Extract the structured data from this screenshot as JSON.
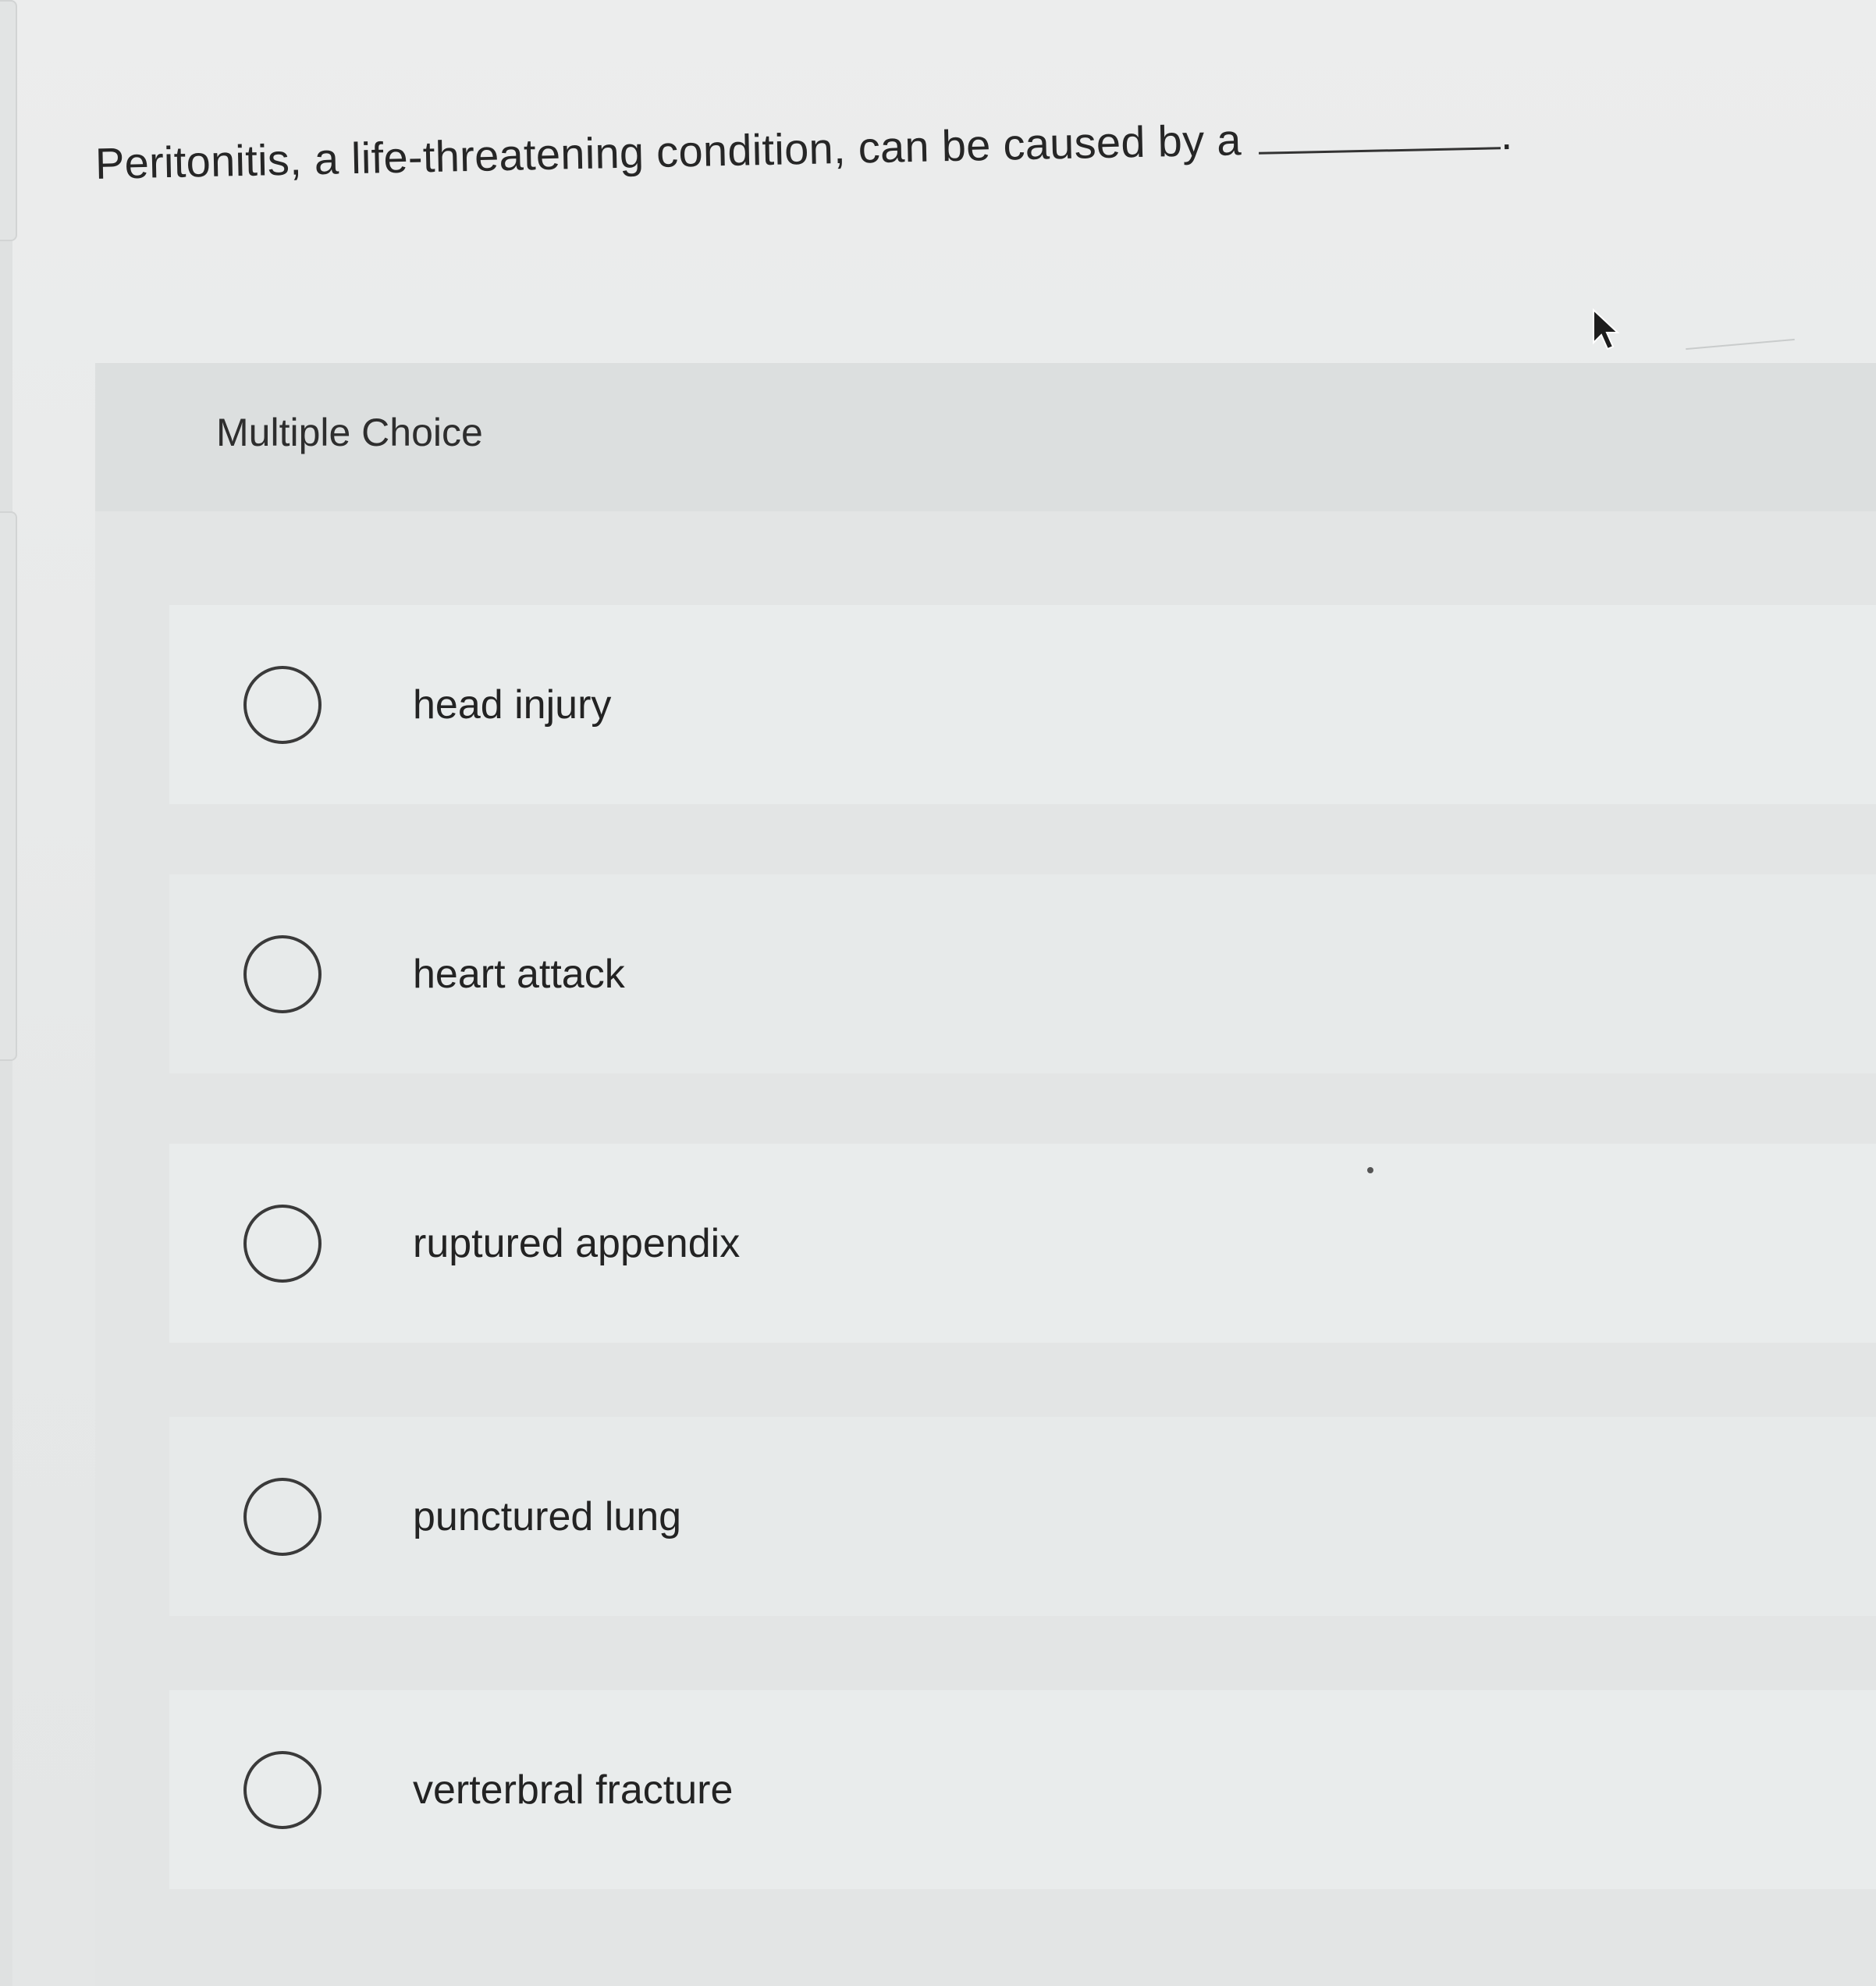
{
  "question": {
    "text": "Peritonitis, a life-threatening condition, can be caused by a",
    "blank_suffix": "."
  },
  "multiple_choice": {
    "label": "Multiple Choice",
    "options": [
      {
        "label": "head injury",
        "selected": false
      },
      {
        "label": "heart attack",
        "selected": false
      },
      {
        "label": "ruptured appendix",
        "selected": false
      },
      {
        "label": "punctured lung",
        "selected": false
      },
      {
        "label": "verterbral fracture",
        "selected": false
      }
    ]
  },
  "icons": {
    "cursor": "mouse-pointer-icon",
    "radio": "radio-button-icon"
  },
  "colors": {
    "background": "#e9eaea",
    "text": "#262626",
    "radio_border": "#3a3a3a"
  }
}
